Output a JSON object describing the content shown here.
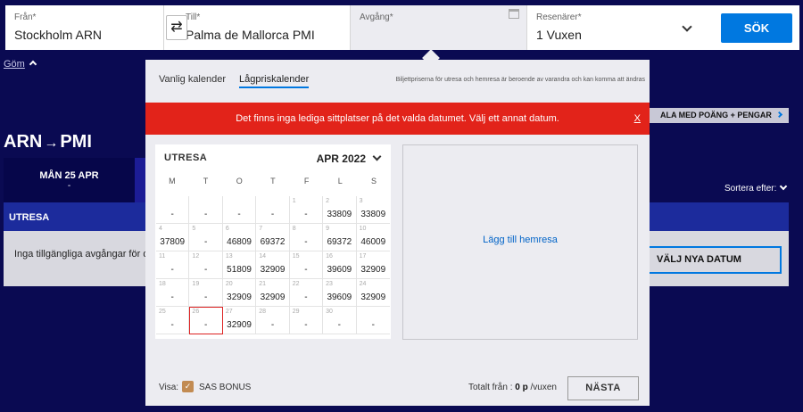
{
  "search": {
    "from_label": "Från*",
    "from_value": "Stockholm ARN",
    "swap_symbol": "⇄",
    "to_label": "Till*",
    "to_value": "Palma de Mallorca PMI",
    "departure_label": "Avgång*",
    "passengers_label": "Resenärer*",
    "passengers_value": "1 Vuxen",
    "search_button": "SÖK"
  },
  "hide_link": "Göm",
  "page": {
    "route_from": "ARN",
    "route_arrow": "→",
    "route_to": "PMI",
    "points_badge": "ALA MED POÄNG + PENGAR",
    "day_tab_label": "MÅN 25 APR",
    "day_tab_sub": "-",
    "sort_label": "Sortera efter:",
    "outbound_header": "UTRESA",
    "no_departures": "Inga tillgängliga avgångar för de",
    "new_dates_button": "VÄLJ NYA DATUM"
  },
  "popup": {
    "tabs": [
      "Vanlig kalender",
      "Lågpriskalender"
    ],
    "active_tab": "Lågpriskalender",
    "price_note": "Biljettpriserna för utresa och hemresa är beroende av varandra och kan komma att ändras",
    "error_message": "Det finns inga lediga sittplatser på det valda datumet. Välj ett annat datum.",
    "error_close": "X",
    "calendar_title": "UTRESA",
    "calendar_month": "APR 2022",
    "weekdays": [
      "M",
      "T",
      "O",
      "T",
      "F",
      "L",
      "S"
    ],
    "selected_day": "26",
    "calendar_cells": [
      {
        "day": "",
        "price": "-"
      },
      {
        "day": "",
        "price": "-"
      },
      {
        "day": "",
        "price": "-"
      },
      {
        "day": "",
        "price": "-"
      },
      {
        "day": "1",
        "price": "-"
      },
      {
        "day": "2",
        "price": "33809"
      },
      {
        "day": "3",
        "price": "33809"
      },
      {
        "day": "4",
        "price": "37809"
      },
      {
        "day": "5",
        "price": "-"
      },
      {
        "day": "6",
        "price": "46809"
      },
      {
        "day": "7",
        "price": "69372"
      },
      {
        "day": "8",
        "price": "-"
      },
      {
        "day": "9",
        "price": "69372"
      },
      {
        "day": "10",
        "price": "46009"
      },
      {
        "day": "11",
        "price": "-"
      },
      {
        "day": "12",
        "price": "-"
      },
      {
        "day": "13",
        "price": "51809"
      },
      {
        "day": "14",
        "price": "32909"
      },
      {
        "day": "15",
        "price": "-"
      },
      {
        "day": "16",
        "price": "39609"
      },
      {
        "day": "17",
        "price": "32909"
      },
      {
        "day": "18",
        "price": "-"
      },
      {
        "day": "19",
        "price": "-"
      },
      {
        "day": "20",
        "price": "32909"
      },
      {
        "day": "21",
        "price": "32909"
      },
      {
        "day": "22",
        "price": "-"
      },
      {
        "day": "23",
        "price": "39609"
      },
      {
        "day": "24",
        "price": "32909"
      },
      {
        "day": "25",
        "price": "-"
      },
      {
        "day": "26",
        "price": "-"
      },
      {
        "day": "27",
        "price": "32909"
      },
      {
        "day": "28",
        "price": "-"
      },
      {
        "day": "29",
        "price": "-"
      },
      {
        "day": "30",
        "price": "-"
      },
      {
        "day": "",
        "price": "-"
      }
    ],
    "add_return": "Lägg till hemresa",
    "visa_label": "Visa:",
    "visa_option": "SAS BONUS",
    "visa_checked": true,
    "total_prefix": "Totalt från :",
    "total_value": "0 p",
    "total_suffix": "/vuxen",
    "next_button": "NÄSTA"
  },
  "colors": {
    "background": "#0a0a52",
    "accent": "#0078e0",
    "error": "#e2231a",
    "checkbox": "#c28b52"
  }
}
